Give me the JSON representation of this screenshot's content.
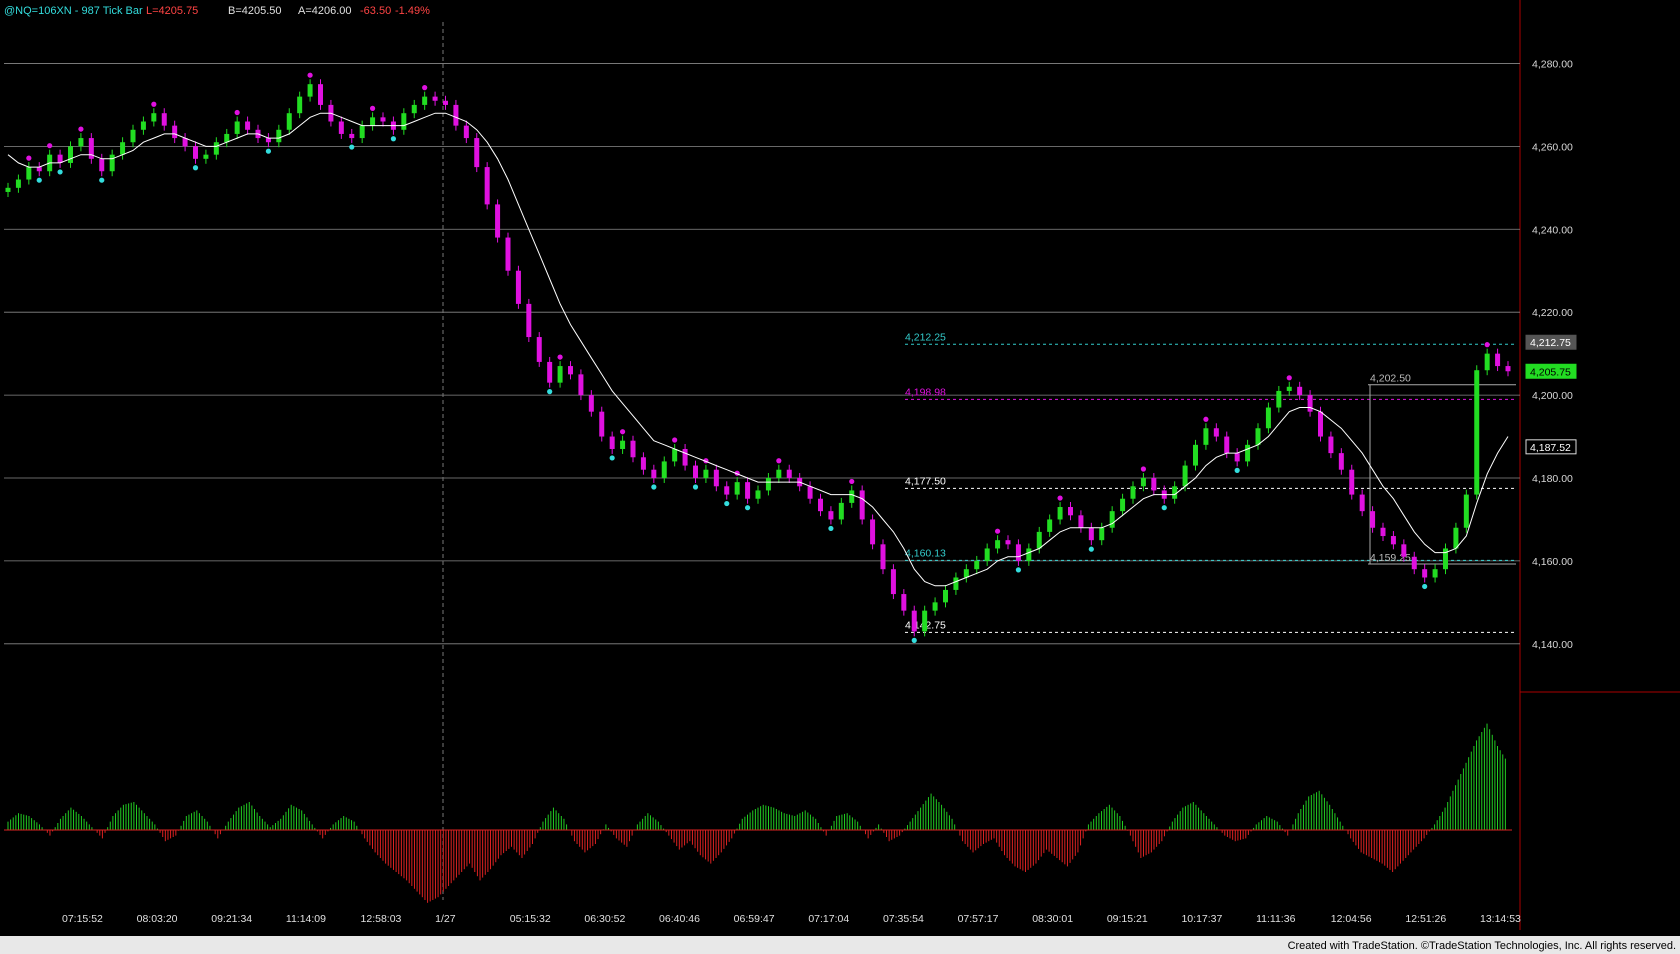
{
  "header": {
    "symbol": "@NQ=106XN - 987 Tick Bar",
    "last": "L=4205.75",
    "bid": "B=4205.50",
    "ask": "A=4206.00",
    "change": "-63.50",
    "change_pct": "-1.49%"
  },
  "colors": {
    "up_bar": "#22dd22",
    "down_bar": "#e011e0",
    "ma_line": "#ffffff",
    "osc_up": "#22cc22",
    "osc_down": "#dd2222",
    "level_cyan": "#33cccc",
    "level_magenta": "#e011e0",
    "level_white": "#ffffff",
    "swing_high": "#e011e0",
    "swing_low": "#33dddd"
  },
  "chart_data": {
    "type": "line",
    "ylim": [
      4125,
      4290
    ],
    "yticks": [
      "4,280.00",
      "4,260.00",
      "4,240.00",
      "4,220.00",
      "4,200.00",
      "4,180.00",
      "4,160.00",
      "4,140.00"
    ],
    "ytick_values": [
      4280,
      4260,
      4240,
      4220,
      4200,
      4180,
      4160,
      4140
    ],
    "x_time_labels": [
      "07:15:52",
      "08:03:20",
      "09:21:34",
      "11:14:09",
      "12:58:03",
      "1/27",
      "05:15:32",
      "06:30:52",
      "06:40:46",
      "06:59:47",
      "07:17:04",
      "07:35:54",
      "07:57:17",
      "08:30:01",
      "09:15:21",
      "10:17:37",
      "11:11:36",
      "12:04:56",
      "12:51:26",
      "13:14:53"
    ],
    "price_series": [
      4250,
      4252,
      4255,
      4254,
      4258,
      4256,
      4260,
      4262,
      4257,
      4254,
      4258,
      4261,
      4264,
      4266,
      4268,
      4265,
      4262,
      4260,
      4257,
      4258,
      4261,
      4263,
      4266,
      4264,
      4262,
      4261,
      4264,
      4268,
      4272,
      4275,
      4270,
      4266,
      4263,
      4262,
      4265,
      4267,
      4266,
      4264,
      4268,
      4270,
      4272,
      4271,
      4270,
      4265,
      4262,
      4255,
      4246,
      4238,
      4230,
      4222,
      4214,
      4208,
      4203,
      4207,
      4205,
      4200,
      4196,
      4190,
      4187,
      4189,
      4185,
      4182,
      4180,
      4184,
      4187,
      4183,
      4180,
      4182,
      4178,
      4176,
      4179,
      4175,
      4177,
      4180,
      4182,
      4180,
      4178,
      4175,
      4172,
      4170,
      4174,
      4177,
      4170,
      4164,
      4158,
      4152,
      4148,
      4143,
      4148,
      4150,
      4153,
      4156,
      4158,
      4160,
      4163,
      4165,
      4164,
      4160,
      4163,
      4167,
      4170,
      4173,
      4171,
      4168,
      4165,
      4168,
      4172,
      4175,
      4178,
      4180,
      4177,
      4175,
      4178,
      4183,
      4188,
      4192,
      4190,
      4186,
      4184,
      4188,
      4192,
      4197,
      4201,
      4202,
      4200,
      4196,
      4190,
      4186,
      4182,
      4176,
      4172,
      4168,
      4166,
      4164,
      4161,
      4158,
      4156,
      4158,
      4163,
      4168,
      4176,
      4206,
      4210,
      4207,
      4205.75
    ],
    "ma_series": [
      4258,
      4256,
      4255,
      4255,
      4256,
      4256,
      4257,
      4258,
      4258,
      4257,
      4257,
      4258,
      4259,
      4261,
      4262,
      4263,
      4263,
      4262,
      4261,
      4260,
      4260,
      4261,
      4262,
      4263,
      4263,
      4262,
      4262,
      4263,
      4265,
      4267,
      4268,
      4268,
      4267,
      4266,
      4265,
      4265,
      4265,
      4265,
      4265,
      4266,
      4267,
      4268,
      4268,
      4267,
      4266,
      4264,
      4261,
      4257,
      4252,
      4246,
      4240,
      4234,
      4228,
      4222,
      4217,
      4213,
      4209,
      4205,
      4201,
      4198,
      4195,
      4192,
      4189,
      4188,
      4187,
      4186,
      4185,
      4184,
      4183,
      4182,
      4181,
      4180,
      4179,
      4179,
      4179,
      4179,
      4179,
      4178,
      4177,
      4176,
      4176,
      4176,
      4175,
      4173,
      4170,
      4167,
      4163,
      4158,
      4155,
      4154,
      4154,
      4155,
      4156,
      4157,
      4158,
      4160,
      4161,
      4161,
      4162,
      4163,
      4165,
      4167,
      4168,
      4168,
      4168,
      4168,
      4169,
      4171,
      4173,
      4175,
      4176,
      4176,
      4176,
      4178,
      4180,
      4183,
      4185,
      4186,
      4186,
      4187,
      4188,
      4190,
      4193,
      4196,
      4197,
      4197,
      4196,
      4194,
      4192,
      4189,
      4186,
      4182,
      4178,
      4175,
      4171,
      4167,
      4164,
      4162,
      4162,
      4163,
      4166,
      4174,
      4181,
      4186,
      4190
    ],
    "oscillator": [
      0.3,
      0.6,
      0.5,
      0.2,
      -0.2,
      0.4,
      0.8,
      0.5,
      0.1,
      -0.3,
      0.5,
      0.9,
      1.0,
      0.6,
      0.2,
      -0.4,
      -0.2,
      0.5,
      0.7,
      0.3,
      -0.3,
      0.3,
      0.8,
      1.0,
      0.5,
      0.1,
      0.4,
      0.9,
      0.7,
      0.2,
      -0.3,
      0.2,
      0.5,
      0.3,
      -0.3,
      -0.8,
      -1.2,
      -1.5,
      -1.8,
      -2.2,
      -2.6,
      -2.4,
      -2.0,
      -1.6,
      -1.2,
      -1.8,
      -1.4,
      -0.9,
      -0.6,
      -1.0,
      -0.5,
      0.3,
      0.8,
      0.4,
      -0.4,
      -0.8,
      -0.5,
      0.2,
      -0.3,
      -0.6,
      0.2,
      0.6,
      0.3,
      -0.2,
      -0.7,
      -0.4,
      -0.9,
      -1.2,
      -0.8,
      -0.3,
      0.4,
      0.7,
      0.9,
      0.8,
      0.6,
      0.5,
      0.7,
      0.4,
      -0.2,
      0.5,
      0.6,
      0.3,
      -0.3,
      0.2,
      -0.4,
      -0.2,
      0.3,
      0.8,
      1.3,
      0.9,
      0.4,
      -0.4,
      -0.8,
      -0.5,
      -0.3,
      -0.9,
      -1.3,
      -1.5,
      -1.2,
      -0.7,
      -1.0,
      -1.3,
      -0.8,
      0.2,
      0.6,
      0.9,
      0.5,
      -0.2,
      -1.0,
      -0.8,
      -0.4,
      0.3,
      0.8,
      1.0,
      0.6,
      0.2,
      -0.2,
      -0.4,
      -0.3,
      0.2,
      0.5,
      0.3,
      -0.2,
      0.6,
      1.2,
      1.4,
      0.9,
      0.3,
      -0.3,
      -0.8,
      -1.0,
      -1.2,
      -1.5,
      -1.1,
      -0.7,
      -0.3,
      0.2,
      0.8,
      1.6,
      2.4,
      3.2,
      3.8,
      3.0,
      2.4
    ],
    "levels": [
      {
        "label": "4,212.25",
        "value": 4212.25,
        "color": "cyan"
      },
      {
        "label": "4,198.98",
        "value": 4198.98,
        "color": "magenta"
      },
      {
        "label": "4,177.50",
        "value": 4177.5,
        "color": "white"
      },
      {
        "label": "4,160.13",
        "value": 4160.13,
        "color": "cyan"
      },
      {
        "label": "4,142.75",
        "value": 4142.75,
        "color": "white"
      }
    ],
    "swing_labels": [
      {
        "label": "4,202.50",
        "value": 4202.5
      },
      {
        "label": "4,159.25",
        "value": 4159.25
      }
    ],
    "price_badges": [
      {
        "label": "4,212.75",
        "value": 4212.75,
        "style": "gray"
      },
      {
        "label": "4,205.75",
        "value": 4205.75,
        "style": "green"
      },
      {
        "label": "4,187.52",
        "value": 4187.52,
        "style": "white"
      }
    ]
  },
  "footer": {
    "credit": "Created with TradeStation. ©TradeStation Technologies, Inc. All rights reserved."
  }
}
